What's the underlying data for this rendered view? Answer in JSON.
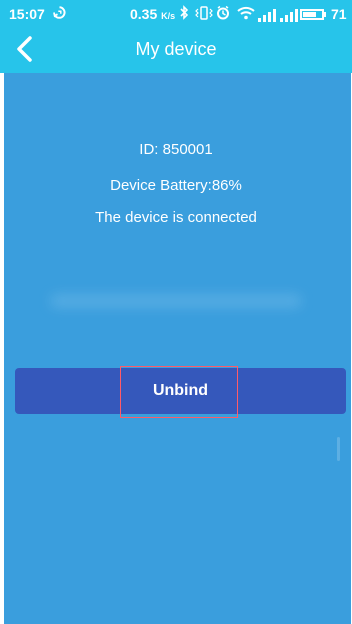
{
  "status_bar": {
    "time": "15:07",
    "network_speed_value": "0.35",
    "network_speed_unit": "K/s",
    "battery_percent": "71",
    "battery_fill_percent": 71,
    "icons": [
      "sync-icon",
      "bluetooth-icon",
      "vibrate-icon",
      "alarm-icon",
      "wifi-icon",
      "cellular-signal-icon",
      "cellular-signal-icon",
      "battery-icon"
    ]
  },
  "header": {
    "title": "My device",
    "back_icon": "chevron-left-icon"
  },
  "device": {
    "id_text": "ID: 850001",
    "battery_text": "Device Battery:86%",
    "status_text": "The device is connected"
  },
  "actions": {
    "unbind_label": "Unbind"
  },
  "colors": {
    "header": "#27C4EA",
    "content_background": "#3A9EDD",
    "button": "#3558BB",
    "highlight": "#FF5B68",
    "text": "#FFFFFF"
  }
}
